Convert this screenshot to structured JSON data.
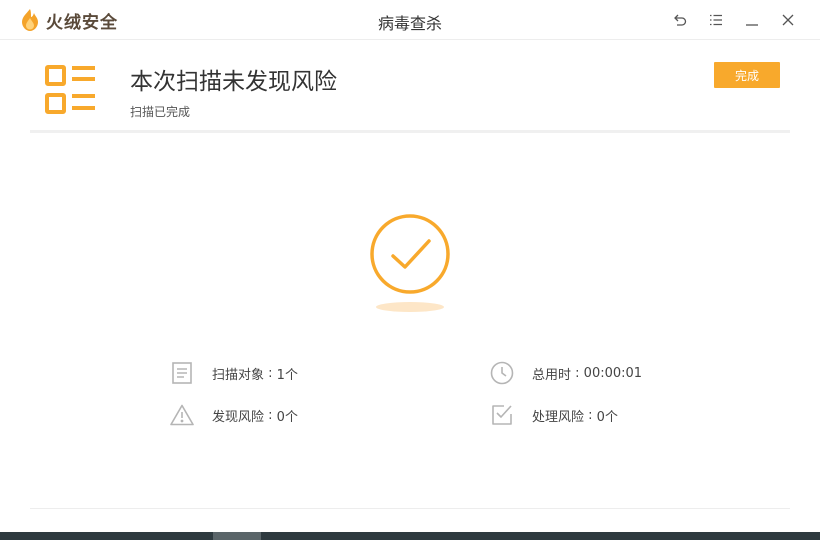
{
  "app": {
    "brand_name": "火绒安全",
    "window_title": "病毒查杀"
  },
  "window_controls": [
    "back-icon",
    "menu-icon",
    "minimize-icon",
    "close-icon"
  ],
  "header": {
    "title": "本次扫描未发现风险",
    "subtitle": "扫描已完成",
    "done_label": "完成"
  },
  "stats": [
    {
      "icon": "document-icon",
      "label": "扫描对象",
      "value": "1个"
    },
    {
      "icon": "clock-icon",
      "label": "总用时",
      "value": "00:00:01"
    },
    {
      "icon": "warning-icon",
      "label": "发现风险",
      "value": "0个"
    },
    {
      "icon": "checkbox-icon",
      "label": "处理风险",
      "value": "0个"
    }
  ],
  "colors": {
    "accent": "#f8a92c",
    "icon_gray": "#b5b5b5"
  }
}
